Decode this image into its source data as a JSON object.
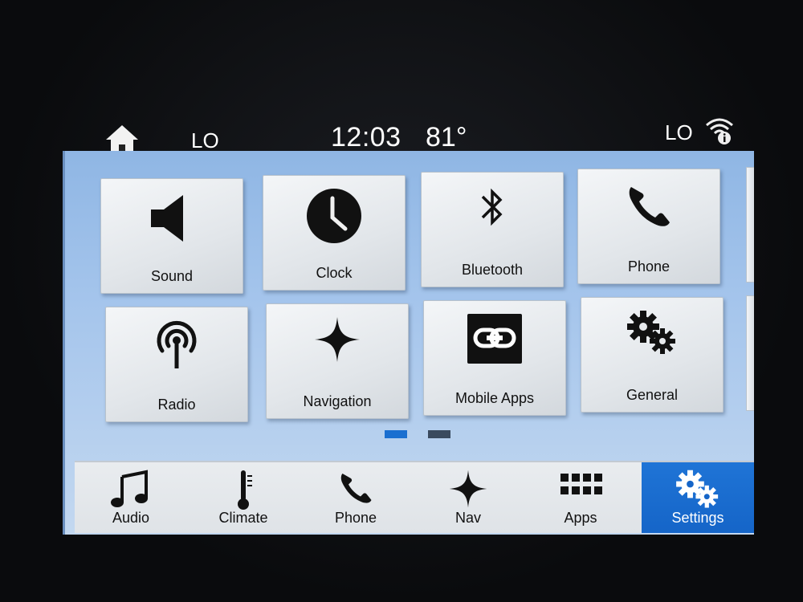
{
  "status_bar": {
    "climate_left": "LO",
    "time": "12:03",
    "outside_temp": "81°",
    "climate_right": "LO",
    "icons": [
      "home-icon",
      "wifi-info-icon"
    ]
  },
  "settings_tiles": [
    {
      "label": "Sound",
      "icon": "speaker-icon"
    },
    {
      "label": "Clock",
      "icon": "clock-icon"
    },
    {
      "label": "Bluetooth",
      "icon": "bluetooth-icon"
    },
    {
      "label": "Phone",
      "icon": "phone-icon"
    },
    {
      "label": "Radio",
      "icon": "radio-icon"
    },
    {
      "label": "Navigation",
      "icon": "compass-star-icon"
    },
    {
      "label": "Mobile Apps",
      "icon": "link-icon"
    },
    {
      "label": "General",
      "icon": "gears-icon"
    }
  ],
  "pager": {
    "pages": 2,
    "current": 1,
    "active_color": "#1a6fd0",
    "inactive_color": "#3a4a5e"
  },
  "bottom_nav": {
    "items": [
      {
        "label": "Audio",
        "icon": "music-note-icon",
        "active": false
      },
      {
        "label": "Climate",
        "icon": "thermometer-icon",
        "active": false
      },
      {
        "label": "Phone",
        "icon": "phone-icon",
        "active": false
      },
      {
        "label": "Nav",
        "icon": "compass-star-icon",
        "active": false
      },
      {
        "label": "Apps",
        "icon": "grid-icon",
        "active": false
      },
      {
        "label": "Settings",
        "icon": "gears-icon",
        "active": true
      }
    ],
    "active_color": "#1565c8"
  }
}
